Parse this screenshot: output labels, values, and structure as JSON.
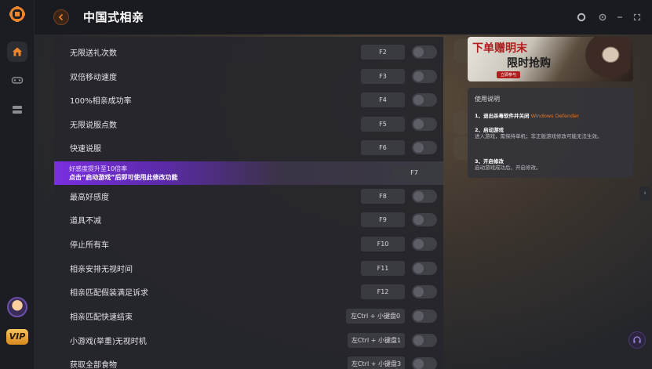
{
  "app": {
    "title": "中国式相亲"
  },
  "rail": {
    "items": [
      {
        "name": "home-icon",
        "active": true
      },
      {
        "name": "gamepad-icon",
        "active": false
      },
      {
        "name": "layers-icon",
        "active": false
      }
    ],
    "vip_label": "VIP"
  },
  "cheats": [
    {
      "label": "无限送礼次数",
      "key": "F2"
    },
    {
      "label": "双倍移动速度",
      "key": "F3"
    },
    {
      "label": "100%相亲成功率",
      "key": "F4"
    },
    {
      "label": "无限说服点数",
      "key": "F5"
    },
    {
      "label": "快速说服",
      "key": "F6"
    },
    {
      "label": "最高好感度",
      "key": "F8"
    },
    {
      "label": "道具不减",
      "key": "F9"
    },
    {
      "label": "停止所有车",
      "key": "F10"
    },
    {
      "label": "相亲安排无视时间",
      "key": "F11"
    },
    {
      "label": "相亲匹配假装满足诉求",
      "key": "F12"
    },
    {
      "label": "相亲匹配快速结束",
      "key": "左Ctrl + 小键盘0"
    },
    {
      "label": "小游戏(举重)无视时机",
      "key": "左Ctrl + 小键盘1"
    },
    {
      "label": "获取全部食物",
      "key": "左Ctrl + 小键盘3"
    }
  ],
  "promo": {
    "line1": "好感度提升至10倍率",
    "line2": "点击“启动游戏”后即可使用此修改功能",
    "key": "F7"
  },
  "banner": {
    "title1": "下单赠明末",
    "title2": "限时抢购",
    "tag": "立即参与"
  },
  "guide": {
    "heading": "使用说明",
    "step1_title": "1、退出杀毒软件并关闭",
    "step1_highlight": "Windows Defender",
    "step2_title": "2、启动游戏",
    "step2_desc": "进入游戏，需保持单机；非正版游戏修改可能无法生效。",
    "step3_title": "3、开启修改",
    "step3_desc": "启动游戏成功后，开启修改。"
  },
  "colors": {
    "accent": "#e87722",
    "promo": "#7a2fe0",
    "vip": "#f6c35d"
  }
}
